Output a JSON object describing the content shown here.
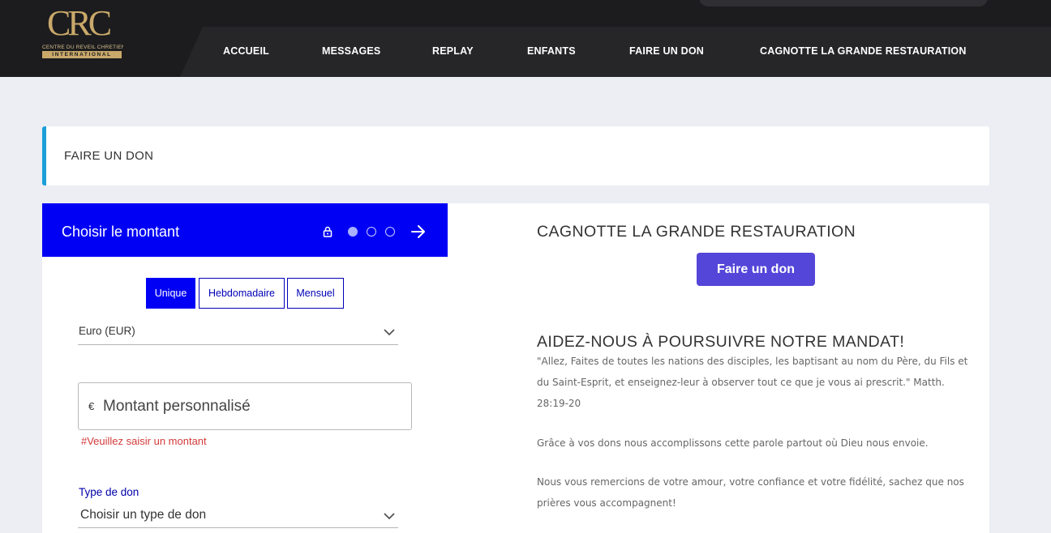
{
  "logo": {
    "mark": "CRC",
    "line1": "CENTRE DU REVEIL CHRETIEN",
    "line2": "INTERNATIONAL",
    "gold_color": "#c9a96a"
  },
  "nav": {
    "items": [
      "ACCUEIL",
      "MESSAGES",
      "REPLAY",
      "ENFANTS",
      "FAIRE UN DON",
      "CAGNOTTE LA GRANDE RESTAURATION"
    ]
  },
  "page": {
    "title": "FAIRE UN DON",
    "accent_color": "#1a9fd9"
  },
  "donation": {
    "header_title": "Choisir le montant",
    "header_color": "#0000f5",
    "step_current": 1,
    "step_total": 3,
    "icons": [
      "lock-icon",
      "arrow-right-icon",
      "chevron-down-icon"
    ],
    "frequency": {
      "options": [
        "Unique",
        "Hebdomadaire",
        "Mensuel"
      ],
      "selected": "Unique"
    },
    "currency": "Euro (EUR)",
    "amount": {
      "symbol": "€",
      "placeholder": "Montant personnalisé",
      "value": "",
      "error": "#Veuillez saisir un montant"
    },
    "type": {
      "label": "Type de don",
      "placeholder": "Choisir un type de don"
    }
  },
  "campaign": {
    "title": "CAGNOTTE LA GRANDE RESTAURATION",
    "button_label": "Faire un don",
    "button_color": "#5446d9",
    "mandate_title": "AIDEZ-NOUS À POURSUIVRE NOTRE MANDAT!",
    "paragraphs": [
      "\"Allez, Faites de toutes les nations des disciples, les baptisant au nom du Père, du Fils et du Saint-Esprit, et enseignez-leur à observer tout ce que je vous ai prescrit.\" Matth. 28:19-20",
      "Grâce à vos dons nous accomplissons cette parole partout où Dieu nous envoie.",
      "Nous vous remercions de votre amour, votre confiance et votre fidélité, sachez que nos prières vous accompagnent!"
    ]
  }
}
